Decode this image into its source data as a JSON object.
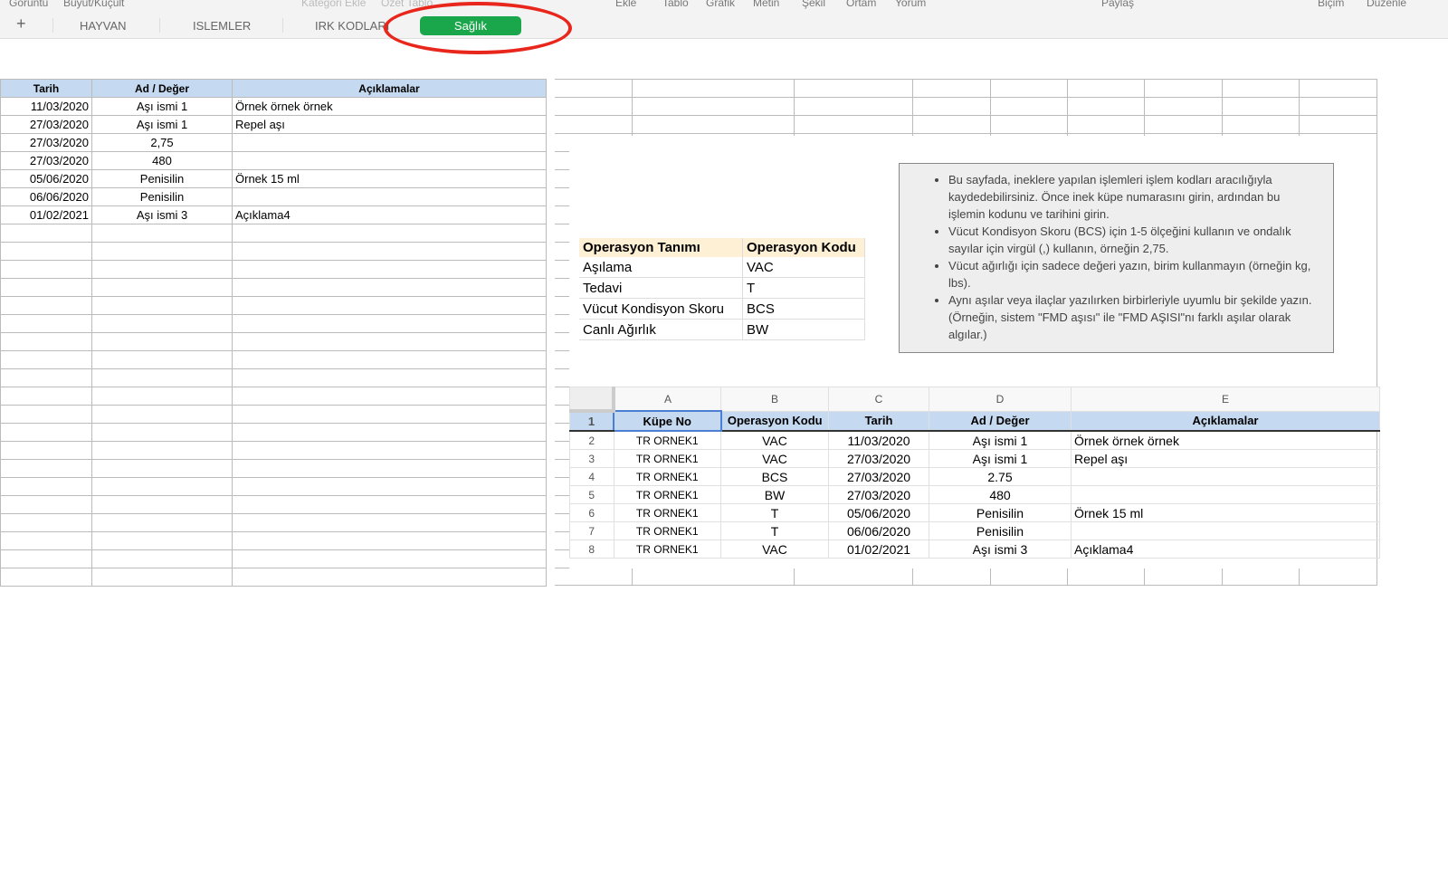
{
  "menu": [
    "Goruntu",
    "Buyut/Kuçult",
    "Kategori Ekle",
    "Ozet Tablo",
    "Ekle",
    "Tablo",
    "Grafik",
    "Metin",
    "Şekil",
    "Ortam",
    "Yorum",
    "Paylaş",
    "Biçim",
    "Duzenle"
  ],
  "tabs": {
    "add": "+",
    "items": [
      "HAYVAN",
      "ISLEMLER",
      "IRK KODLARI"
    ],
    "active": "Sağlık"
  },
  "left_table": {
    "headers": [
      "Tarih",
      "Ad / Değer",
      "Açıklamalar"
    ],
    "rows": [
      [
        "11/03/2020",
        "Aşı ismi 1",
        "Örnek örnek örnek"
      ],
      [
        "27/03/2020",
        "Aşı ismi 1",
        "Repel aşı"
      ],
      [
        "27/03/2020",
        "2,75",
        ""
      ],
      [
        "27/03/2020",
        "480",
        ""
      ],
      [
        "05/06/2020",
        "Penisilin",
        "Örnek 15 ml"
      ],
      [
        "06/06/2020",
        "Penisilin",
        ""
      ],
      [
        "01/02/2021",
        "Aşı ismi 3",
        "Açıklama4"
      ]
    ]
  },
  "ops": {
    "headers": [
      "Operasyon Tanımı",
      "Operasyon Kodu"
    ],
    "rows": [
      [
        "Aşılama",
        "VAC"
      ],
      [
        "Tedavi",
        "T"
      ],
      [
        "Vücut Kondisyon Skoru",
        "BCS"
      ],
      [
        "Canlı Ağırlık",
        "BW"
      ]
    ]
  },
  "notes": [
    "Bu sayfada, ineklere yapılan işlemleri işlem kodları aracılığıyla kaydedebilirsiniz. Önce inek küpe numarasını girin, ardından bu işlemin kodunu ve tarihini girin.",
    "Vücut Kondisyon Skoru (BCS) için 1-5 ölçeğini kullanın ve ondalık sayılar için virgül (,) kullanın, örneğin 2,75.",
    "Vücut ağırlığı için sadece değeri yazın, birim kullanmayın (örneğin kg, lbs).",
    "Aynı aşılar veya ilaçlar yazılırken birbirleriyle uyumlu bir şekilde yazın. (Örneğin, sistem \"FMD aşısı\" ile \"FMD AŞISI\"nı farklı aşılar olarak algılar.)"
  ],
  "example": {
    "cols": [
      "A",
      "B",
      "C",
      "D",
      "E"
    ],
    "headers": [
      "Küpe No",
      "Operasyon Kodu",
      "Tarih",
      "Ad / Değer",
      "Açıklamalar"
    ],
    "rows": [
      [
        "TR ORNEK1",
        "VAC",
        "11/03/2020",
        "Aşı ismi 1",
        "Örnek örnek örnek"
      ],
      [
        "TR ORNEK1",
        "VAC",
        "27/03/2020",
        "Aşı ismi 1",
        "Repel aşı"
      ],
      [
        "TR ORNEK1",
        "BCS",
        "27/03/2020",
        "2.75",
        ""
      ],
      [
        "TR ORNEK1",
        "BW",
        "27/03/2020",
        "480",
        ""
      ],
      [
        "TR ORNEK1",
        "T",
        "05/06/2020",
        "Penisilin",
        "Örnek 15 ml"
      ],
      [
        "TR ORNEK1",
        "T",
        "06/06/2020",
        "Penisilin",
        ""
      ],
      [
        "TR ORNEK1",
        "VAC",
        "01/02/2021",
        "Aşı ismi 3",
        "Açıklama4"
      ]
    ],
    "row_numbers": [
      "1",
      "2",
      "3",
      "4",
      "5",
      "6",
      "7",
      "8"
    ]
  },
  "colors": {
    "active_tab": "#1aa64a",
    "header_blue": "#c5d9f1",
    "highlight": "#e8261c"
  }
}
